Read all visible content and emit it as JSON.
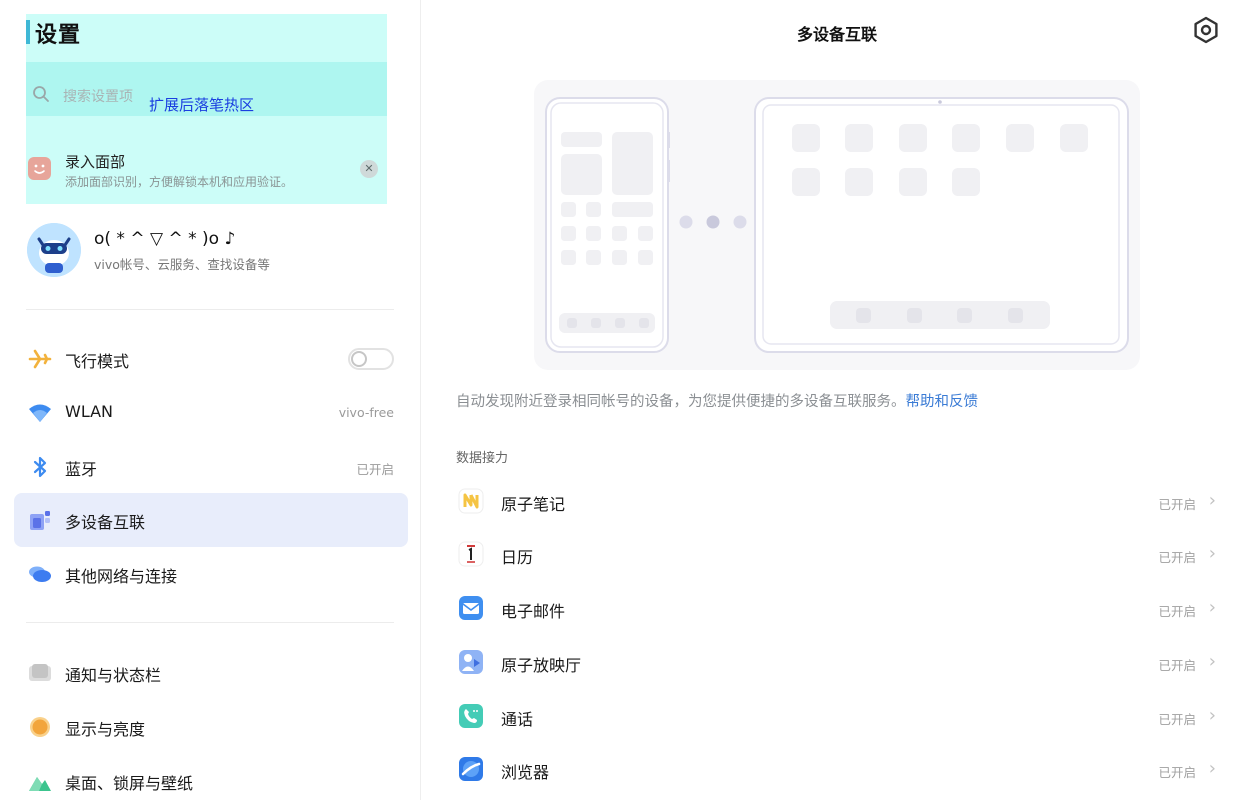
{
  "left": {
    "title": "设置",
    "search_placeholder": "搜索设置项",
    "hotzone_label": "扩展后落笔热区",
    "face_prompt": {
      "title": "录入面部",
      "subtitle": "添加面部识别，方便解锁本机和应用验证。",
      "close": "✕"
    },
    "account": {
      "name": "o( * ^ ▽ ^ * )o ♪",
      "subtitle": "vivo帐号、云服务、查找设备等"
    },
    "items": [
      {
        "label": "飞行模式",
        "value": "",
        "toggle": false,
        "icon": "airplane-icon",
        "color": "#f2b23c"
      },
      {
        "label": "WLAN",
        "value": "vivo-free",
        "icon": "wifi-icon",
        "color": "#3d8bf0"
      },
      {
        "label": "蓝牙",
        "value": "已开启",
        "icon": "bluetooth-icon",
        "color": "#3d8bf0"
      },
      {
        "label": "多设备互联",
        "value": "",
        "icon": "multi-device-icon",
        "color": "#6c7ef0",
        "selected": true
      },
      {
        "label": "其他网络与连接",
        "value": "",
        "icon": "network-icon",
        "color": "#3d7cf0"
      },
      {
        "label": "通知与状态栏",
        "value": "",
        "icon": "notification-icon",
        "color": "#bdbdbd"
      },
      {
        "label": "显示与亮度",
        "value": "",
        "icon": "brightness-icon",
        "color": "#f2a53c"
      },
      {
        "label": "桌面、锁屏与壁纸",
        "value": "",
        "icon": "wallpaper-icon",
        "color": "#3cc48e"
      }
    ]
  },
  "right": {
    "title": "多设备互联",
    "description": "自动发现附近登录相同帐号的设备，为您提供便捷的多设备互联服务。",
    "help_link": "帮助和反馈",
    "section_title": "数据接力",
    "apps": [
      {
        "label": "原子笔记",
        "status": "已开启",
        "icon": "notes-icon"
      },
      {
        "label": "日历",
        "status": "已开启",
        "icon": "calendar-icon"
      },
      {
        "label": "电子邮件",
        "status": "已开启",
        "icon": "email-icon"
      },
      {
        "label": "原子放映厅",
        "status": "已开启",
        "icon": "video-icon"
      },
      {
        "label": "通话",
        "status": "已开启",
        "icon": "phone-icon"
      },
      {
        "label": "浏览器",
        "status": "已开启",
        "icon": "browser-icon"
      }
    ]
  },
  "colors": {
    "hotzone": "#ccfdf8",
    "selected_bg": "#e8edfb",
    "link": "#3a7bd5"
  }
}
